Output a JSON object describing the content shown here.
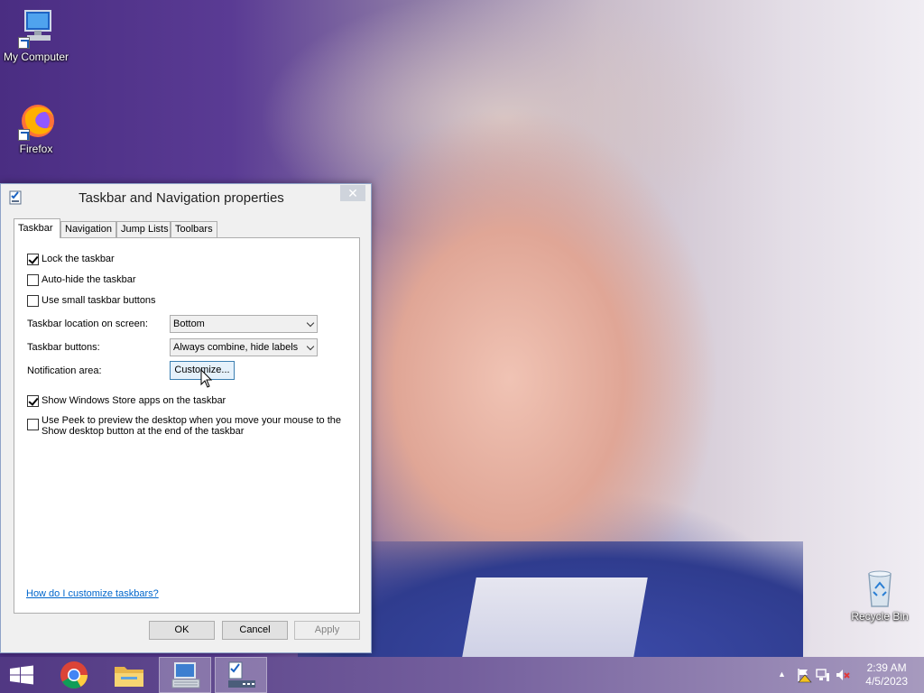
{
  "desktop": {
    "icons": [
      {
        "label": "My Computer"
      },
      {
        "label": "Firefox"
      },
      {
        "label": "Recycle Bin"
      }
    ]
  },
  "dialog": {
    "title": "Taskbar and Navigation properties",
    "tabs": [
      {
        "label": "Taskbar",
        "active": true
      },
      {
        "label": "Navigation"
      },
      {
        "label": "Jump Lists"
      },
      {
        "label": "Toolbars"
      }
    ],
    "checkboxes": {
      "lock_taskbar": {
        "label": "Lock the taskbar",
        "checked": true
      },
      "auto_hide": {
        "label": "Auto-hide the taskbar",
        "checked": false
      },
      "small_buttons": {
        "label": "Use small taskbar buttons",
        "checked": false
      },
      "store_apps": {
        "label": "Show Windows Store apps on the taskbar",
        "checked": true
      },
      "peek": {
        "label": "Use Peek to preview the desktop when you move your mouse to the",
        "label2": "Show desktop button at the end of the taskbar",
        "checked": false
      }
    },
    "location": {
      "label": "Taskbar location on screen:",
      "value": "Bottom"
    },
    "buttons_setting": {
      "label": "Taskbar buttons:",
      "value": "Always combine, hide labels"
    },
    "notification": {
      "label": "Notification area:",
      "button": "Customize..."
    },
    "help_link": "How do I customize taskbars?",
    "ok": "OK",
    "cancel": "Cancel",
    "apply": "Apply"
  },
  "taskbar": {
    "time": "2:39 AM",
    "date": "4/5/2023"
  },
  "colors": {
    "link": "#0066cc",
    "focus_button": "#e5f1fb"
  }
}
